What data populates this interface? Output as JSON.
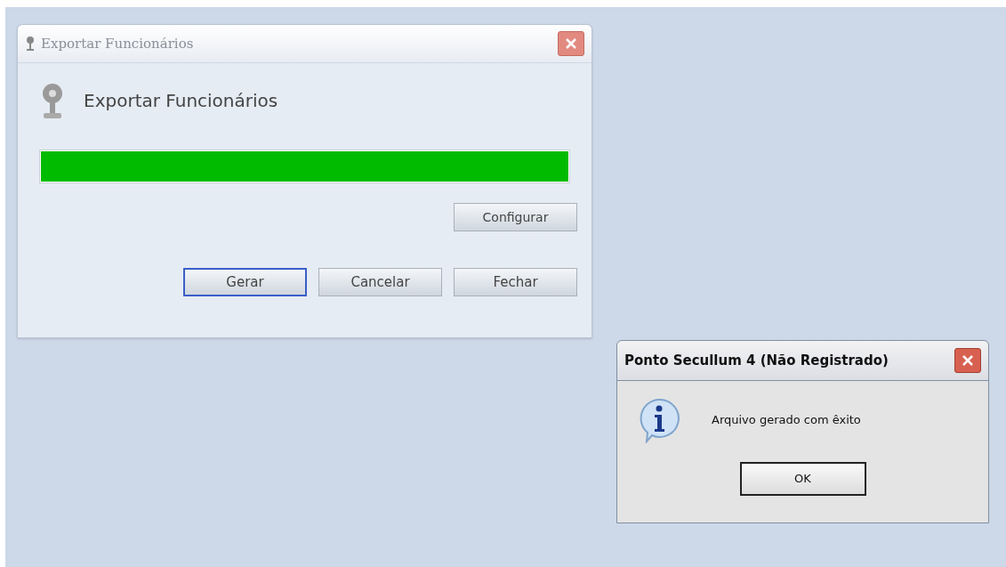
{
  "export_window": {
    "title": "Exportar Funcionários",
    "heading": "Exportar Funcionários",
    "progress": {
      "level": 1
    },
    "configure_button": "Configurar",
    "buttons": [
      {
        "label": "Gerar",
        "focused": true
      },
      {
        "label": "Cancelar",
        "focused": false
      },
      {
        "label": "Fechar",
        "focused": false
      }
    ]
  },
  "message_box": {
    "title": "Ponto Secullum 4 (Não Registrado)",
    "message": "Arquivo gerado com êxito",
    "button": "OK"
  }
}
